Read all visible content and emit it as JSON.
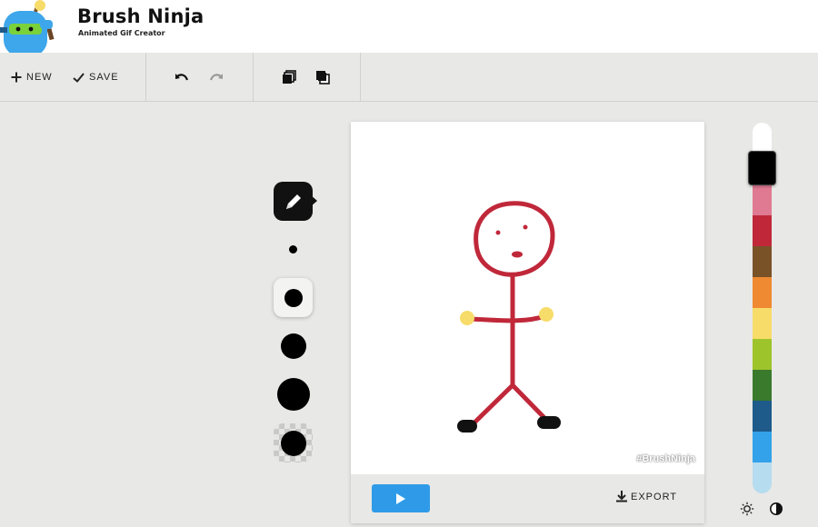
{
  "app": {
    "title": "Brush Ninja",
    "subtitle": "Animated Gif Creator"
  },
  "toolbar": {
    "new_label": "NEW",
    "save_label": "SAVE",
    "icons": [
      "plus-icon",
      "check-icon",
      "undo-icon",
      "redo-icon",
      "layers-back-icon",
      "layers-front-icon"
    ]
  },
  "tools": {
    "pencil_icon": "pencil-icon",
    "brush_sizes": [
      "x-small",
      "small",
      "medium",
      "large",
      "eraser"
    ],
    "selected": "small"
  },
  "canvas": {
    "watermark": "#BrushNinja"
  },
  "footer": {
    "export_label": "EXPORT",
    "play_icon": "play-icon",
    "export_icon": "download-icon"
  },
  "palette": {
    "selected": "#000000",
    "colors": [
      "#ffffff",
      "#000000",
      "#e07a92",
      "#c0283a",
      "#7a5228",
      "#ef8a32",
      "#f7dc6a",
      "#9ec42c",
      "#3a7a2c",
      "#1e5a8a",
      "#34a2ea",
      "#b6dcef"
    ]
  },
  "mode_icons": [
    "brightness-icon",
    "contrast-icon"
  ]
}
